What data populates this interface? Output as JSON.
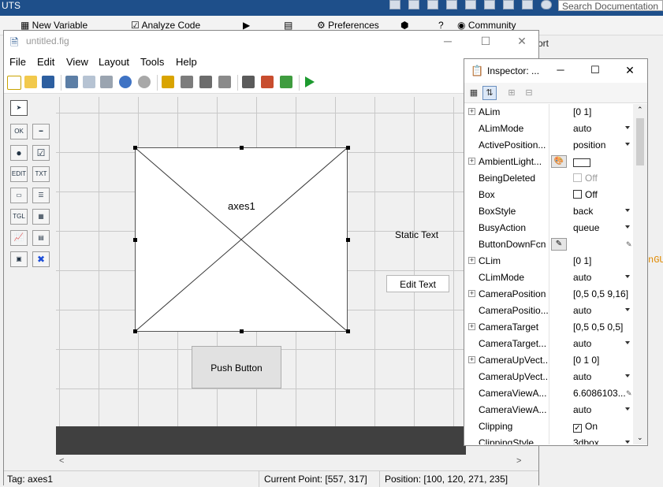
{
  "matlab": {
    "title_fragment": "UTS",
    "toolstrip": {
      "new_variable": "New Variable",
      "analyze_code": "Analyze Code",
      "preferences": "Preferences",
      "community": "Community"
    },
    "search_placeholder": "Search Documentation",
    "right_edge_text": "ort",
    "right_edge_code": "nGU"
  },
  "guide": {
    "title": "untitled.fig",
    "window_controls": {
      "minimize": "─",
      "maximize": "☐",
      "close": "✕"
    },
    "menu": [
      "File",
      "Edit",
      "View",
      "Layout",
      "Tools",
      "Help"
    ],
    "palette": [
      {
        "icon": "pointer-icon",
        "label": "➤"
      },
      {
        "icon": "push-button-icon",
        "label": "OK"
      },
      {
        "icon": "slider-icon",
        "label": "━"
      },
      {
        "icon": "radio-button-icon",
        "label": "●"
      },
      {
        "icon": "checkbox-icon",
        "label": "☑"
      },
      {
        "icon": "edit-text-icon",
        "label": "EDIT"
      },
      {
        "icon": "static-text-icon",
        "label": "TXT"
      },
      {
        "icon": "popup-menu-icon",
        "label": "▭"
      },
      {
        "icon": "listbox-icon",
        "label": "☰"
      },
      {
        "icon": "toggle-button-icon",
        "label": "TGL"
      },
      {
        "icon": "table-icon",
        "label": "▦"
      },
      {
        "icon": "axes-icon",
        "label": "📈"
      },
      {
        "icon": "panel-icon",
        "label": "▤"
      },
      {
        "icon": "button-group-icon",
        "label": "▣"
      },
      {
        "icon": "activex-icon",
        "label": "✖"
      }
    ],
    "components": {
      "axes_label": "axes1",
      "static_text": "Static Text",
      "edit_text": "Edit Text",
      "push_button": "Push Button"
    },
    "status": {
      "tag": "Tag: axes1",
      "current_point": "Current Point:  [557, 317]",
      "position": "Position: [100, 120, 271, 235]"
    }
  },
  "inspector": {
    "title": "Inspector: ...",
    "window_controls": {
      "minimize": "─",
      "maximize": "☐",
      "close": "✕"
    },
    "properties": [
      {
        "name": "ALim",
        "value": "[0 1]",
        "expand": true,
        "kind": "text"
      },
      {
        "name": "ALimMode",
        "value": "auto",
        "kind": "dropdown"
      },
      {
        "name": "ActivePosition...",
        "value": "position",
        "kind": "dropdown"
      },
      {
        "name": "AmbientLight...",
        "value": "",
        "expand": true,
        "kind": "color"
      },
      {
        "name": "BeingDeleted",
        "value": "Off",
        "kind": "checkbox-disabled"
      },
      {
        "name": "Box",
        "value": "Off",
        "kind": "checkbox"
      },
      {
        "name": "BoxStyle",
        "value": "back",
        "kind": "dropdown"
      },
      {
        "name": "BusyAction",
        "value": "queue",
        "kind": "dropdown"
      },
      {
        "name": "ButtonDownFcn",
        "value": "",
        "kind": "callback"
      },
      {
        "name": "CLim",
        "value": "[0 1]",
        "expand": true,
        "kind": "text"
      },
      {
        "name": "CLimMode",
        "value": "auto",
        "kind": "dropdown"
      },
      {
        "name": "CameraPosition",
        "value": "[0,5 0,5 9,16]",
        "expand": true,
        "kind": "text"
      },
      {
        "name": "CameraPositio...",
        "value": "auto",
        "kind": "dropdown"
      },
      {
        "name": "CameraTarget",
        "value": "[0,5 0,5 0,5]",
        "expand": true,
        "kind": "text"
      },
      {
        "name": "CameraTarget...",
        "value": "auto",
        "kind": "dropdown"
      },
      {
        "name": "CameraUpVect...",
        "value": "[0 1 0]",
        "expand": true,
        "kind": "text"
      },
      {
        "name": "CameraUpVect...",
        "value": "auto",
        "kind": "dropdown"
      },
      {
        "name": "CameraViewA...",
        "value": "6.6086103...",
        "kind": "edit"
      },
      {
        "name": "CameraViewA...",
        "value": "auto",
        "kind": "dropdown"
      },
      {
        "name": "Clipping",
        "value": "On",
        "kind": "checkbox-checked"
      },
      {
        "name": "ClippingStyle",
        "value": "3dbox",
        "kind": "dropdown"
      }
    ]
  }
}
